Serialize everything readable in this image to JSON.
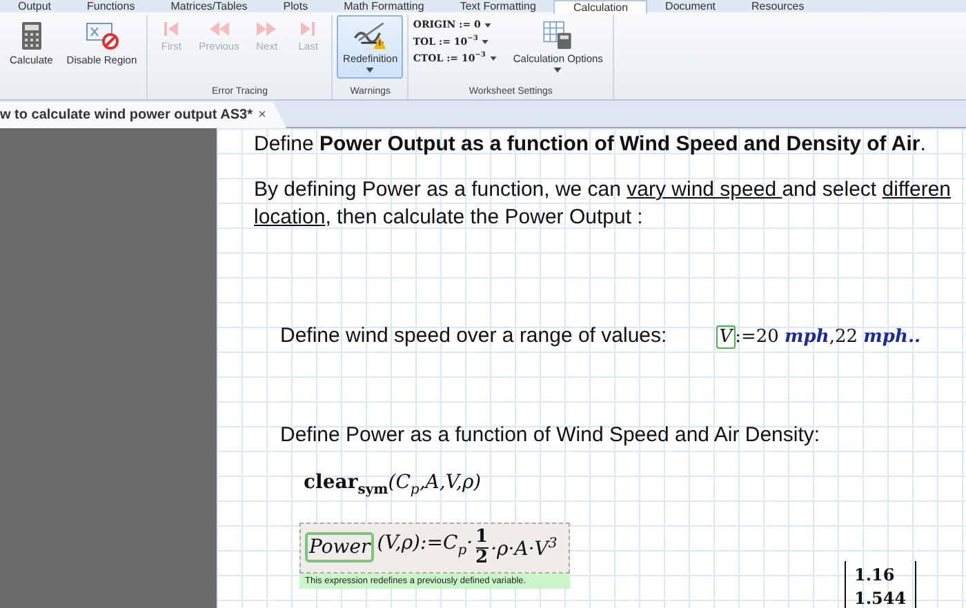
{
  "ribbon_tabs": [
    {
      "label": "Output",
      "selected": false
    },
    {
      "label": "Functions",
      "selected": false
    },
    {
      "label": "Matrices/Tables",
      "selected": false
    },
    {
      "label": "Plots",
      "selected": false
    },
    {
      "label": "Math Formatting",
      "selected": false
    },
    {
      "label": "Text Formatting",
      "selected": false
    },
    {
      "label": "Calculation",
      "selected": true
    },
    {
      "label": "Document",
      "selected": false
    },
    {
      "label": "Resources",
      "selected": false
    }
  ],
  "ribbon_groups": [
    {
      "buttons": [
        {
          "kind": "calculate",
          "label": "Calculate",
          "disabled": false,
          "selected": false
        },
        {
          "kind": "disable",
          "label": "Disable Region",
          "disabled": false,
          "selected": false
        }
      ]
    },
    {
      "label": "Error Tracing",
      "buttons": [
        {
          "kind": "first",
          "label": "First",
          "disabled": true,
          "selected": false
        },
        {
          "kind": "previous",
          "label": "Previous",
          "disabled": true,
          "selected": false
        },
        {
          "kind": "next",
          "label": "Next",
          "disabled": true,
          "selected": false
        },
        {
          "kind": "last",
          "label": "Last",
          "disabled": true,
          "selected": false
        }
      ]
    },
    {
      "label": "Warnings",
      "buttons": [
        {
          "kind": "redefinition",
          "label": "Redefinition",
          "disabled": false,
          "selected": true,
          "dropdown": true
        }
      ]
    },
    {
      "label": "Worksheet Settings",
      "settings": [
        {
          "name": "ORIGIN",
          "assign": ":=",
          "value": "0"
        },
        {
          "name": "TOL",
          "assign": ":=",
          "value": "10$^{−3}$"
        },
        {
          "name": "CTOL",
          "assign": ":=",
          "value": "10$^{−3}$"
        }
      ],
      "buttons": [
        {
          "kind": "options",
          "label": "Calculation Options",
          "disabled": false,
          "selected": false,
          "dropdown": true
        }
      ]
    }
  ],
  "document_tab": {
    "title": "w to calculate wind power output AS3*",
    "close": "×"
  },
  "worksheet": {
    "heading": "Define **Power Output as a function of Wind Speed and Density of Air**.",
    "paragraph_lines": [
      [
        {
          "kind": "text",
          "text": "By defining Power as a function, we can "
        },
        {
          "kind": "link",
          "text": "vary wind speed "
        },
        {
          "kind": "text",
          "text": "and select "
        },
        {
          "kind": "link",
          "text": "differen"
        }
      ],
      [
        {
          "kind": "link",
          "text": "location"
        },
        {
          "kind": "text",
          "text": ", then calculate the Power Output :"
        }
      ]
    ],
    "wind_speed_label": "Define wind speed over a range of values:",
    "wind_speed_def": {
      "variable": "V",
      "assign": ":=",
      "values": [
        {
          "number": "20",
          "unit": "mph"
        },
        {
          "number": "22",
          "unit": "mph"
        }
      ],
      "separator": ",",
      "range": ".."
    },
    "power_label": "Define Power as a function of Wind Speed and Air Density:",
    "clear": {
      "function": "clear",
      "subscript": "sym",
      "args": "(C$_{p}$,A,V,ρ)"
    },
    "power_def": {
      "name": "Power",
      "args": "(V,ρ)",
      "assign": ":=",
      "before": "C$_{p}$·",
      "numerator": "1",
      "denominator": "2",
      "after": "·ρ·A·V$^{3}$",
      "warning": "This expression redefines a previously defined variable."
    },
    "matrix": [
      "1.16",
      "1.544"
    ]
  }
}
